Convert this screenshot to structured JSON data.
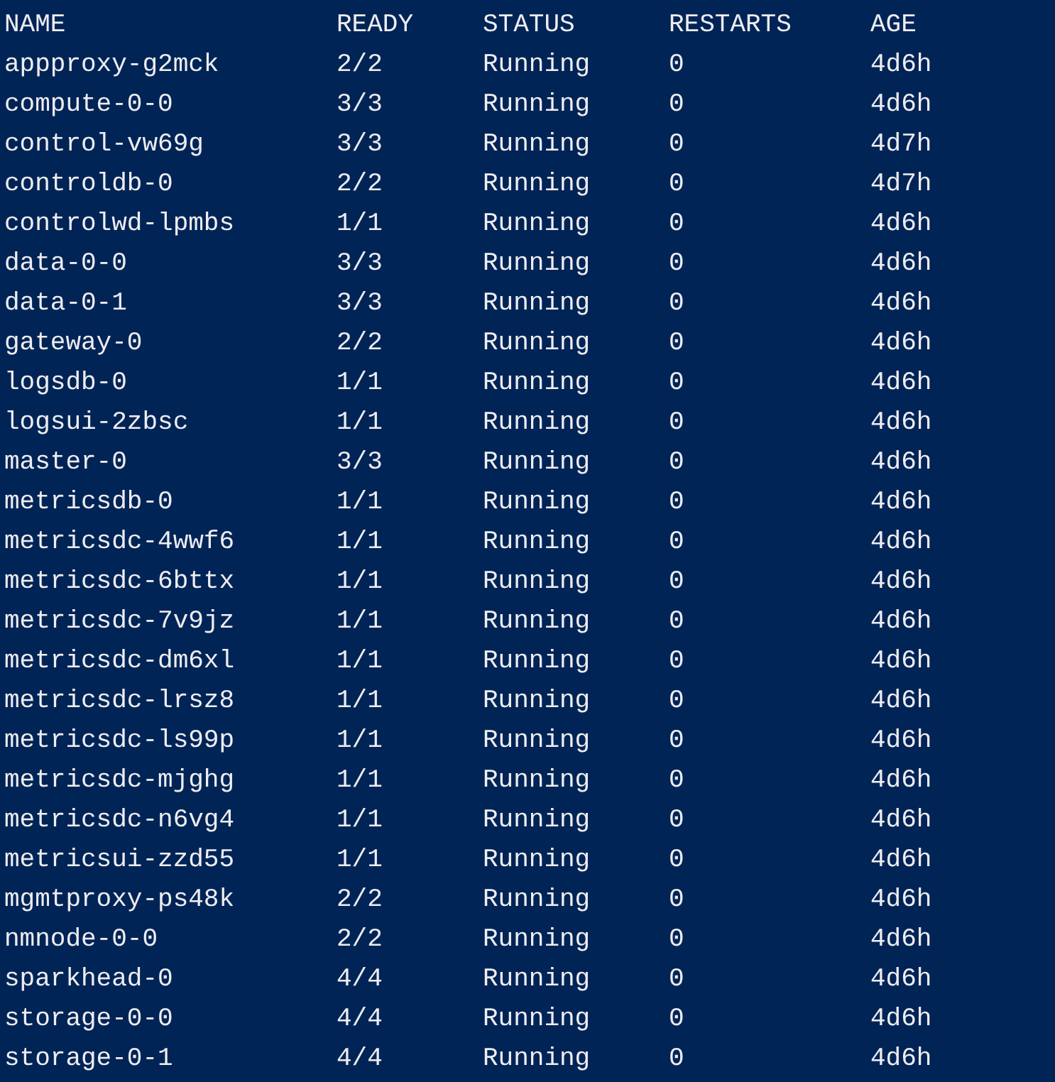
{
  "table": {
    "columns": [
      "NAME",
      "READY",
      "STATUS",
      "RESTARTS",
      "AGE"
    ],
    "rows": [
      [
        "appproxy-g2mck",
        "2/2",
        "Running",
        "0",
        "4d6h"
      ],
      [
        "compute-0-0",
        "3/3",
        "Running",
        "0",
        "4d6h"
      ],
      [
        "control-vw69g",
        "3/3",
        "Running",
        "0",
        "4d7h"
      ],
      [
        "controldb-0",
        "2/2",
        "Running",
        "0",
        "4d7h"
      ],
      [
        "controlwd-lpmbs",
        "1/1",
        "Running",
        "0",
        "4d6h"
      ],
      [
        "data-0-0",
        "3/3",
        "Running",
        "0",
        "4d6h"
      ],
      [
        "data-0-1",
        "3/3",
        "Running",
        "0",
        "4d6h"
      ],
      [
        "gateway-0",
        "2/2",
        "Running",
        "0",
        "4d6h"
      ],
      [
        "logsdb-0",
        "1/1",
        "Running",
        "0",
        "4d6h"
      ],
      [
        "logsui-2zbsc",
        "1/1",
        "Running",
        "0",
        "4d6h"
      ],
      [
        "master-0",
        "3/3",
        "Running",
        "0",
        "4d6h"
      ],
      [
        "metricsdb-0",
        "1/1",
        "Running",
        "0",
        "4d6h"
      ],
      [
        "metricsdc-4wwf6",
        "1/1",
        "Running",
        "0",
        "4d6h"
      ],
      [
        "metricsdc-6bttx",
        "1/1",
        "Running",
        "0",
        "4d6h"
      ],
      [
        "metricsdc-7v9jz",
        "1/1",
        "Running",
        "0",
        "4d6h"
      ],
      [
        "metricsdc-dm6xl",
        "1/1",
        "Running",
        "0",
        "4d6h"
      ],
      [
        "metricsdc-lrsz8",
        "1/1",
        "Running",
        "0",
        "4d6h"
      ],
      [
        "metricsdc-ls99p",
        "1/1",
        "Running",
        "0",
        "4d6h"
      ],
      [
        "metricsdc-mjghg",
        "1/1",
        "Running",
        "0",
        "4d6h"
      ],
      [
        "metricsdc-n6vg4",
        "1/1",
        "Running",
        "0",
        "4d6h"
      ],
      [
        "metricsui-zzd55",
        "1/1",
        "Running",
        "0",
        "4d6h"
      ],
      [
        "mgmtproxy-ps48k",
        "2/2",
        "Running",
        "0",
        "4d6h"
      ],
      [
        "nmnode-0-0",
        "2/2",
        "Running",
        "0",
        "4d6h"
      ],
      [
        "sparkhead-0",
        "4/4",
        "Running",
        "0",
        "4d6h"
      ],
      [
        "storage-0-0",
        "4/4",
        "Running",
        "0",
        "4d6h"
      ],
      [
        "storage-0-1",
        "4/4",
        "Running",
        "0",
        "4d6h"
      ]
    ]
  }
}
